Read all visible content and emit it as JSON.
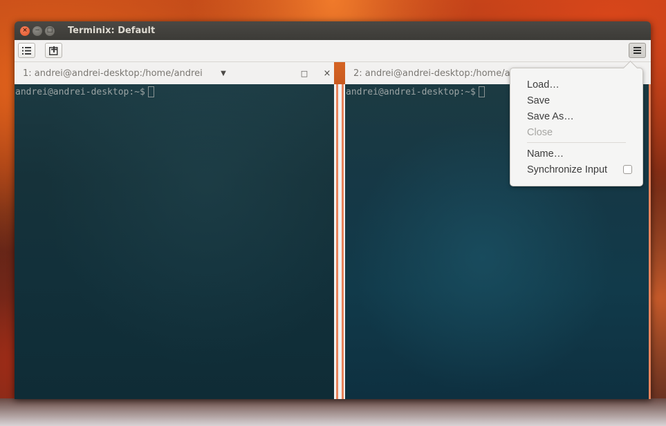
{
  "window": {
    "title": "Terminix: Default",
    "controls": {
      "close": "×",
      "minimize": "−",
      "maximize": "□"
    }
  },
  "toolbar": {
    "list_icon": "list-icon",
    "add_session_icon": "add-terminal-icon",
    "menu_icon": "hamburger-icon"
  },
  "panes": [
    {
      "title": "1: andrei@andrei-desktop:/home/andrei",
      "prompt": "andrei@andrei-desktop:~$",
      "controls": {
        "dropdown": "▼",
        "maximize": "□",
        "close": "×"
      }
    },
    {
      "title": "2: andrei@andrei-desktop:/home/andrei",
      "prompt": "andrei@andrei-desktop:~$"
    }
  ],
  "menu": {
    "items": [
      {
        "label": "Load…",
        "enabled": true
      },
      {
        "label": "Save",
        "enabled": true
      },
      {
        "label": "Save As…",
        "enabled": true
      },
      {
        "label": "Close",
        "enabled": false
      },
      {
        "label": "Name…",
        "enabled": true
      },
      {
        "label": "Synchronize Input",
        "enabled": true,
        "checkbox": false
      }
    ]
  },
  "colors": {
    "accent": "#e9835b",
    "terminal_bg": "#16323a",
    "title_bar": "#3c3b37"
  }
}
